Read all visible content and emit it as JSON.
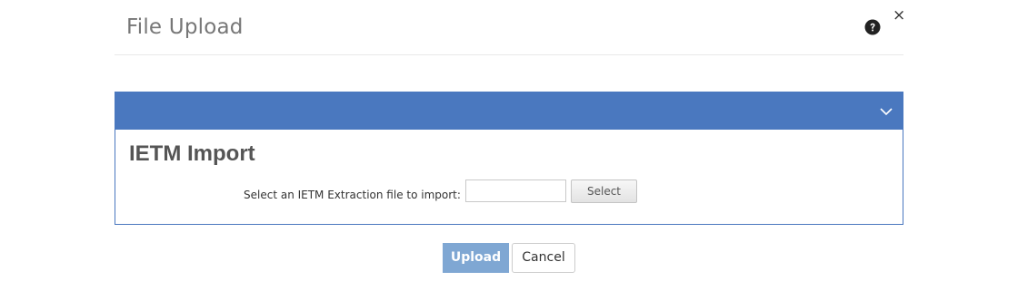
{
  "dialog": {
    "title": "File Upload",
    "help_icon": "question-circle-icon",
    "close_icon": "close-icon",
    "close_glyph": "×"
  },
  "panel": {
    "title": "IETM Import",
    "header_color": "#4a78bf",
    "collapse_icon": "chevron-down-icon",
    "field": {
      "label": "Select an IETM Extraction file to import:",
      "value": "",
      "placeholder": ""
    },
    "select_button_label": "Select"
  },
  "footer": {
    "upload_label": "Upload",
    "upload_color": "#7fa7d3",
    "cancel_label": "Cancel"
  }
}
